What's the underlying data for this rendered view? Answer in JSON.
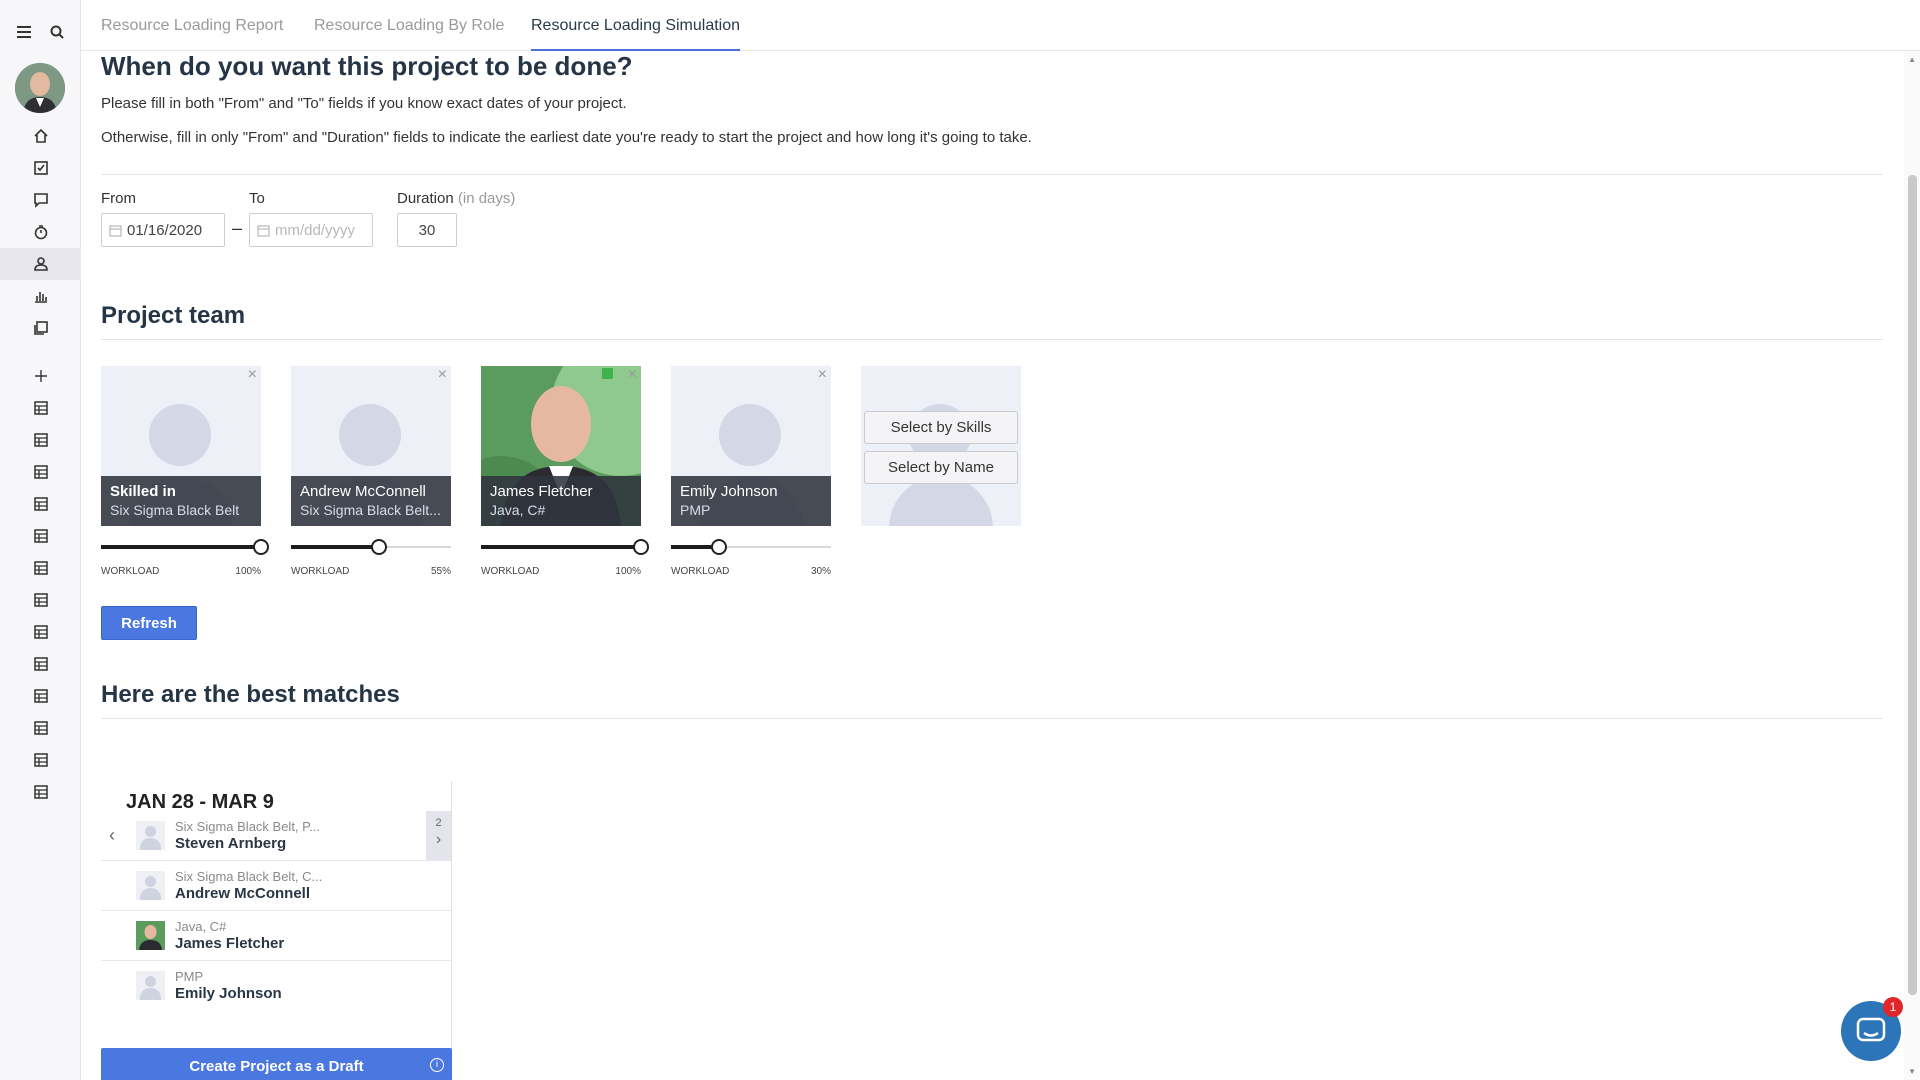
{
  "sidebar": {
    "menu_icon": "hamburger-icon",
    "search_icon": "search-icon",
    "nav_icons": [
      "home-icon",
      "tasks-icon",
      "comments-icon",
      "timer-icon",
      "user-icon",
      "chart-icon",
      "documents-icon"
    ],
    "add_icon": "plus-icon",
    "table_icons_count_label": "13"
  },
  "tabs": [
    {
      "label": "Resource Loading Report"
    },
    {
      "label": "Resource Loading By Role"
    },
    {
      "label": "Resource Loading Simulation"
    }
  ],
  "schedule": {
    "heading": "When do you want this project to be done?",
    "line1": "Please fill in both \"From\" and \"To\" fields if you know exact dates of your project.",
    "line2": "Otherwise, fill in only \"From\" and \"Duration\" fields to indicate the earliest date you're ready to start the project and how long it's going to take.",
    "from_label": "From",
    "from_value": "01/16/2020",
    "to_label": "To",
    "to_placeholder": "mm/dd/yyyy",
    "dash": "–",
    "duration_label": "Duration",
    "duration_hint": "(in days)",
    "duration_value": "30"
  },
  "team": {
    "heading": "Project team",
    "workload_label": "WORKLOAD",
    "members": [
      {
        "name": "Skilled in",
        "subtitle": "Six Sigma Black Belt",
        "workload_text": "100%",
        "workload": 1.0,
        "photo": false
      },
      {
        "name": "Andrew McConnell",
        "subtitle": "Six Sigma Black Belt...",
        "workload_text": "55%",
        "workload": 0.55,
        "photo": false
      },
      {
        "name": "James Fletcher",
        "subtitle": "Java, C#",
        "workload_text": "100%",
        "workload": 1.0,
        "photo": true
      },
      {
        "name": "Emily Johnson",
        "subtitle": "PMP",
        "workload_text": "30%",
        "workload": 0.3,
        "photo": false
      }
    ],
    "select_skills": "Select by Skills",
    "select_name": "Select by Name",
    "refresh": "Refresh"
  },
  "matches": {
    "heading": "Here are the best matches",
    "range": "JAN 28 - MAR 9",
    "page_count": "2",
    "rows": [
      {
        "skills": "Six Sigma Black Belt, P...",
        "name": "Steven Arnberg"
      },
      {
        "skills": "Six Sigma Black Belt, C...",
        "name": "Andrew McConnell"
      },
      {
        "skills": "Java, C#",
        "name": "James Fletcher"
      },
      {
        "skills": "PMP",
        "name": "Emily Johnson"
      }
    ],
    "create_draft": "Create Project as a Draft",
    "info_glyph": "i"
  },
  "chat": {
    "badge": "1"
  },
  "colors": {
    "accent": "#4a77e0",
    "heading": "#263545",
    "badge": "#e0262b"
  }
}
